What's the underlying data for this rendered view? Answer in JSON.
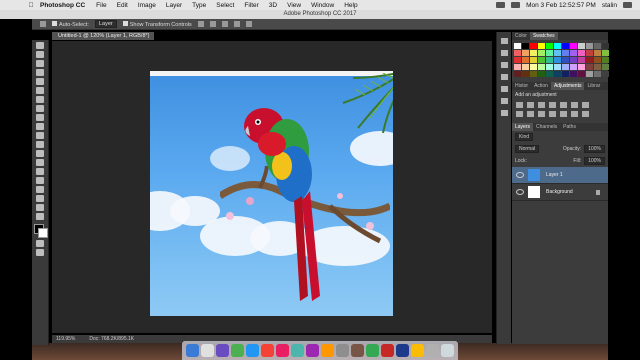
{
  "menubar": {
    "app_name": "Photoshop CC",
    "items": [
      "File",
      "Edit",
      "Image",
      "Layer",
      "Type",
      "Select",
      "Filter",
      "3D",
      "View",
      "Window",
      "Help"
    ],
    "datetime": "Mon 3 Feb  12:52:57 PM",
    "user": "stalin"
  },
  "window": {
    "title": "Adobe Photoshop CC 2017"
  },
  "options": {
    "auto_select": "Auto-Select:",
    "auto_select_value": "Layer",
    "transform_controls": "Show Transform Controls"
  },
  "document": {
    "tab": "Untitled-1 @ 120% (Layer 1, RGB/8*)",
    "zoom": "119.95%",
    "doc_info": "Doc: 768.2K/895.1K"
  },
  "panels": {
    "top_tabs": [
      "Color",
      "Swatches"
    ],
    "mid_tabs": [
      "Histor",
      "Action",
      "Adjustments",
      "Librar"
    ],
    "adjustment_label": "Add an adjustment",
    "layer_tabs": [
      "Layers",
      "Channels",
      "Paths"
    ],
    "kind": "Kind",
    "blend_mode": "Normal",
    "opacity_label": "Opacity:",
    "opacity_value": "100%",
    "lock_label": "Lock:",
    "fill_label": "Fill:",
    "fill_value": "100%",
    "layers": [
      {
        "name": "Layer 1",
        "selected": true
      },
      {
        "name": "Background",
        "selected": false
      }
    ]
  },
  "swatch_colors": [
    "#ffffff",
    "#000000",
    "#ff0000",
    "#ffff00",
    "#00ff00",
    "#00ffff",
    "#0000ff",
    "#ff00ff",
    "#cccccc",
    "#999999",
    "#666666",
    "#333333",
    "#f06060",
    "#f0a060",
    "#f0f060",
    "#a0f060",
    "#60f0a0",
    "#60c0f0",
    "#6080f0",
    "#a060f0",
    "#f060c0",
    "#c04040",
    "#c08040",
    "#80c040",
    "#e03030",
    "#e07030",
    "#e0d030",
    "#50c030",
    "#30c090",
    "#3090e0",
    "#3050c0",
    "#7040c0",
    "#c040a0",
    "#902020",
    "#905020",
    "#508020",
    "#ffb0b0",
    "#ffd0a0",
    "#ffffa0",
    "#c0ffa0",
    "#a0ffe0",
    "#a0e0ff",
    "#a0b0ff",
    "#d0a0ff",
    "#ffa0e0",
    "#804040",
    "#806040",
    "#608040",
    "#602020",
    "#603010",
    "#606010",
    "#206010",
    "#106050",
    "#104060",
    "#102060",
    "#401060",
    "#601040",
    "#a0a0a0",
    "#707070",
    "#404040"
  ],
  "dock_colors": [
    "#3a7bd5",
    "#e0e0e0",
    "#6a4cc2",
    "#4caf50",
    "#2196f3",
    "#f44336",
    "#e91e63",
    "#4db6ac",
    "#9c27b0",
    "#ff9800",
    "#8e8e8e",
    "#795548",
    "#34a853",
    "#c62828",
    "#1e3a8a",
    "#fbbc05",
    "#b0b0b0",
    "#cfd8dc"
  ]
}
